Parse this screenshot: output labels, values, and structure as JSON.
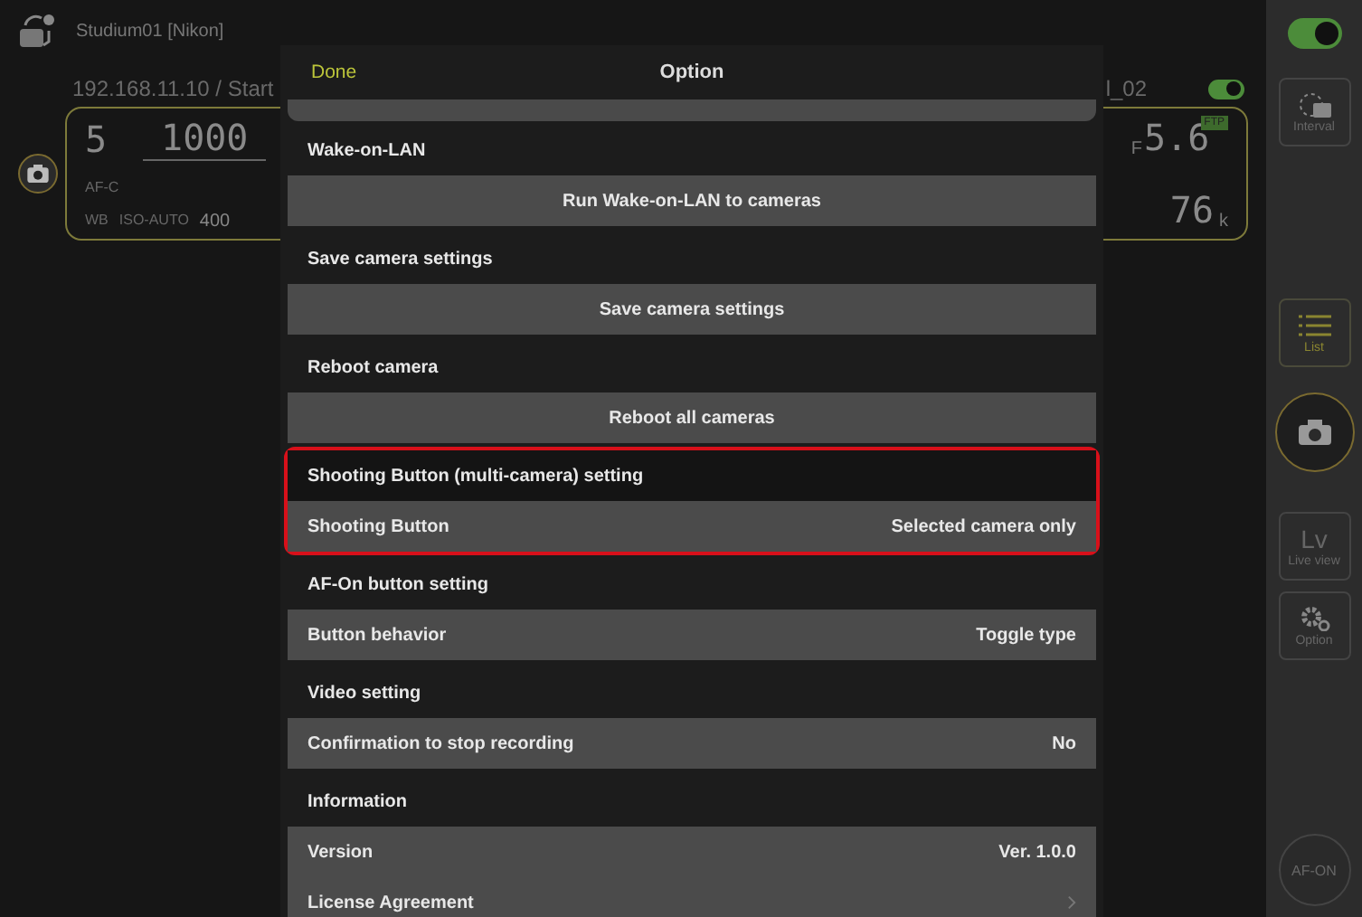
{
  "background": {
    "group_title": "Studium01 [Nikon]",
    "address": "192.168.11.10 / Start",
    "camera_name": "l_02",
    "camera_toggle": {
      "on": true
    },
    "camera": {
      "mode": "5",
      "shutter": "1000",
      "af_mode": "AF-C",
      "wb": "WB",
      "iso_label": "ISO-AUTO",
      "iso": "400",
      "aperture_prefix": "F",
      "aperture": "5.6",
      "ftp_badge": "FTP",
      "remaining": "76",
      "remaining_unit": "k"
    }
  },
  "toolbar": {
    "toggle": {
      "on": true
    },
    "items": [
      {
        "kind": "interval",
        "label": "Interval",
        "selected": false
      },
      {
        "kind": "list",
        "label": "List",
        "selected": true
      },
      {
        "kind": "shutter"
      },
      {
        "kind": "liveview",
        "glyph": "Lv",
        "label": "Live view",
        "selected": false
      },
      {
        "kind": "option",
        "label": "Option",
        "selected": false
      },
      {
        "kind": "round",
        "label": "AF-ON"
      }
    ]
  },
  "sheet": {
    "done": "Done",
    "title": "Option",
    "sections": [
      {
        "title": "Wake-on-LAN",
        "highlighted": false,
        "rows": [
          {
            "kind": "action",
            "label": "Run Wake-on-LAN to cameras"
          }
        ]
      },
      {
        "title": "Save camera settings",
        "highlighted": false,
        "rows": [
          {
            "kind": "action",
            "label": "Save camera settings"
          }
        ]
      },
      {
        "title": "Reboot camera",
        "highlighted": false,
        "rows": [
          {
            "kind": "action",
            "label": "Reboot all cameras"
          }
        ]
      },
      {
        "title": "Shooting Button (multi-camera) setting",
        "highlighted": true,
        "rows": [
          {
            "kind": "value",
            "label": "Shooting Button",
            "value": "Selected camera only"
          }
        ]
      },
      {
        "title": "AF-On button setting",
        "highlighted": false,
        "rows": [
          {
            "kind": "value",
            "label": "Button behavior",
            "value": "Toggle type"
          }
        ]
      },
      {
        "title": "Video setting",
        "highlighted": false,
        "rows": [
          {
            "kind": "value",
            "label": "Confirmation to stop recording",
            "value": "No"
          }
        ]
      },
      {
        "title": "Information",
        "highlighted": false,
        "rows": [
          {
            "kind": "value",
            "label": "Version",
            "value": "Ver. 1.0.0"
          },
          {
            "kind": "link",
            "label": "License Agreement"
          }
        ]
      }
    ]
  }
}
